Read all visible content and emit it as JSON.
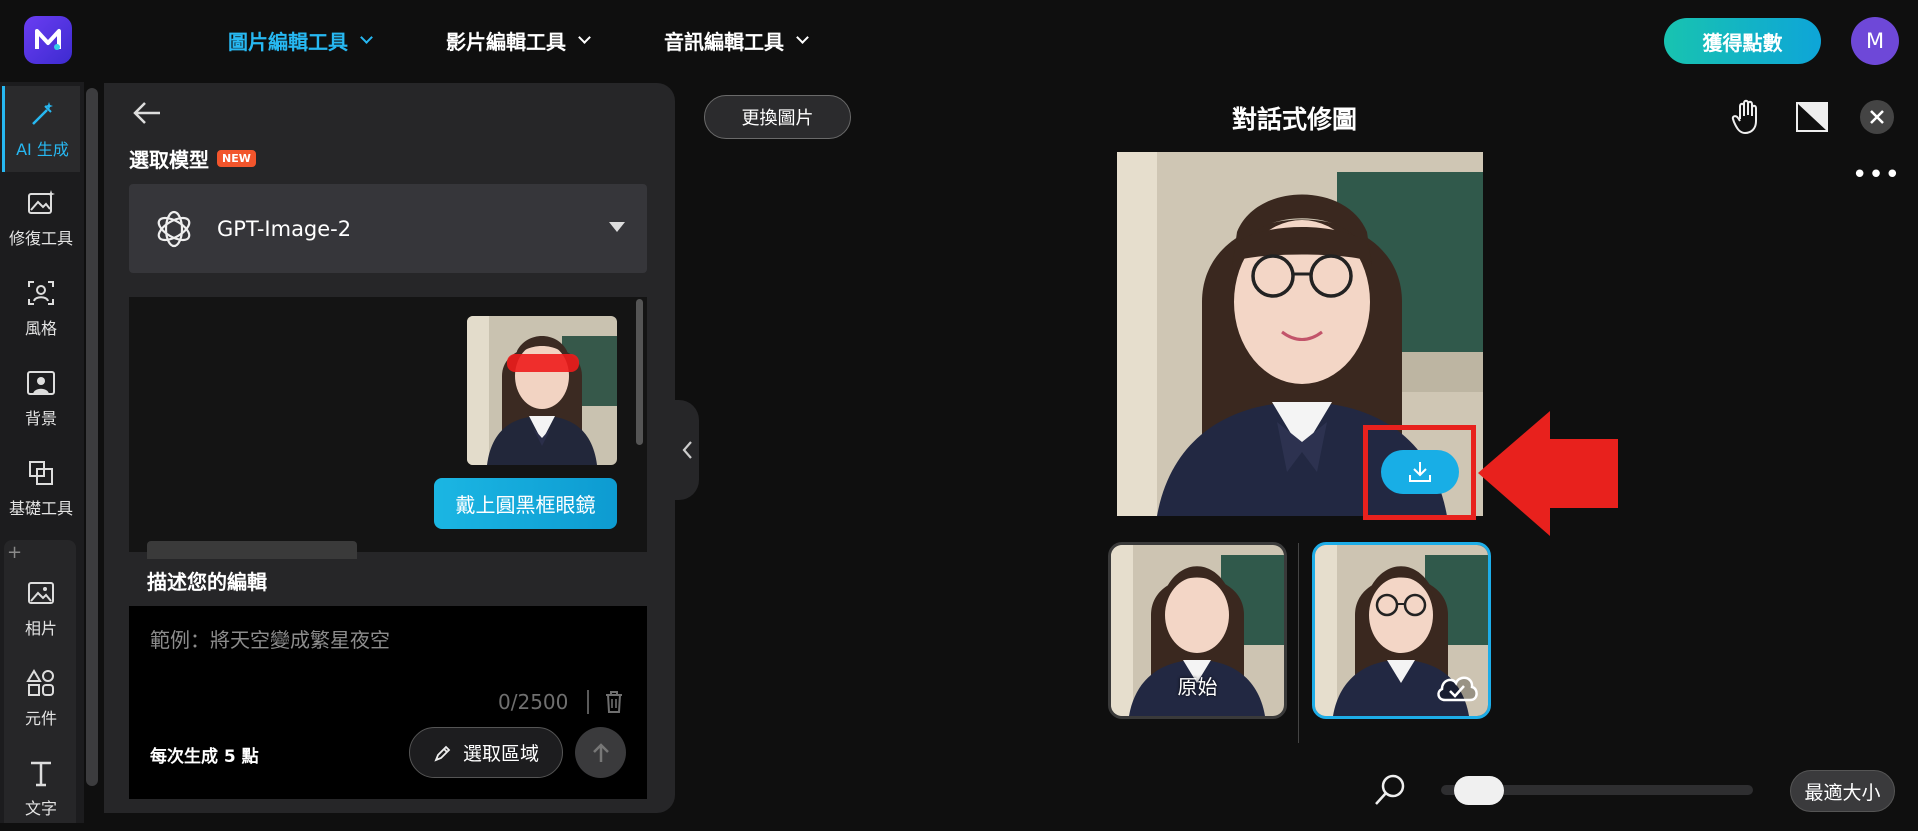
{
  "header": {
    "logo_letter": "M",
    "nav": [
      {
        "label": "圖片編輯工具",
        "active": true
      },
      {
        "label": "影片編輯工具",
        "active": false
      },
      {
        "label": "音訊編輯工具",
        "active": false
      }
    ],
    "points_button": "獲得點數",
    "avatar_initial": "M",
    "accent_color": "#27b8f2"
  },
  "toolrail": {
    "items": [
      {
        "label": "AI 生成",
        "icon": "magic-wand-icon",
        "active": true
      },
      {
        "label": "修復工具",
        "icon": "image-repair-icon"
      },
      {
        "label": "風格",
        "icon": "style-portrait-icon"
      },
      {
        "label": "背景",
        "icon": "background-icon"
      },
      {
        "label": "基礎工具",
        "icon": "crop-icon"
      },
      {
        "label": "相片",
        "icon": "photo-icon"
      },
      {
        "label": "元件",
        "icon": "shapes-icon"
      },
      {
        "label": "文字",
        "icon": "text-icon"
      }
    ],
    "add_symbol": "+"
  },
  "panel": {
    "model_section_title": "選取模型",
    "new_badge": "NEW",
    "model_name": "GPT-Image-2",
    "chat_message": "戴上圓黑框眼鏡",
    "description_label": "描述您的編輯",
    "description_placeholder": "範例：將天空變成繁星夜空",
    "char_counter": "0/2500",
    "cost_text": "每次生成 5 點",
    "select_area_button": "選取區域"
  },
  "canvas": {
    "replace_image_button": "更換圖片",
    "title": "對話式修圖",
    "more_symbol": "•••",
    "thumbnails": [
      {
        "label": "原始",
        "selected": false
      },
      {
        "label": "",
        "selected": true
      }
    ],
    "zoom_level": 0.05,
    "fit_button": "最適大小"
  }
}
